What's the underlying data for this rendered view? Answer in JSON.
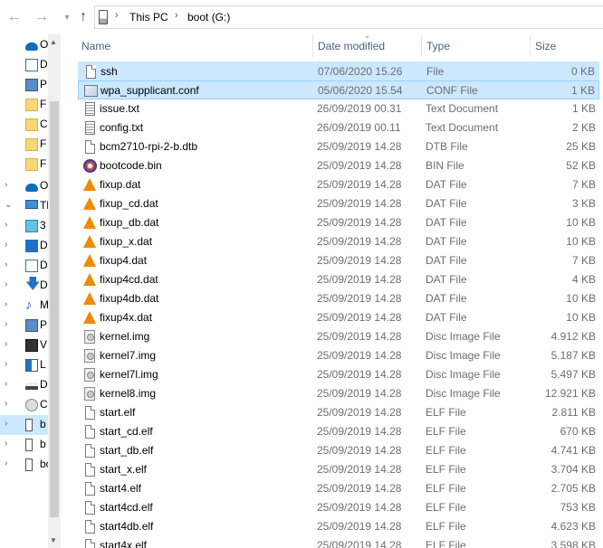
{
  "address": {
    "crumbs": [
      "This PC",
      "boot (G:)"
    ],
    "separator": "›"
  },
  "nav": {
    "items": [
      {
        "label": "O",
        "icon": "onedrive-icon",
        "expandable": false
      },
      {
        "label": "D",
        "icon": "document-icon",
        "expandable": false
      },
      {
        "label": "P",
        "icon": "picture-icon",
        "expandable": false
      },
      {
        "label": "F",
        "icon": "folder-icon",
        "expandable": false
      },
      {
        "label": "C",
        "icon": "folder-icon",
        "expandable": false
      },
      {
        "label": "F",
        "icon": "folder-icon",
        "expandable": false
      },
      {
        "label": "F",
        "icon": "folder-icon",
        "expandable": false
      },
      {
        "label": "O",
        "icon": "onedrive-icon",
        "expandable": true
      },
      {
        "label": "Th",
        "icon": "this-pc-icon",
        "expandable": true,
        "expanded": true
      },
      {
        "label": "3",
        "icon": "3d-objects-icon",
        "expandable": true
      },
      {
        "label": "D",
        "icon": "desktop-icon",
        "expandable": true
      },
      {
        "label": "D",
        "icon": "documents-icon",
        "expandable": true
      },
      {
        "label": "D",
        "icon": "downloads-icon",
        "expandable": true
      },
      {
        "label": "M",
        "icon": "music-icon",
        "expandable": true
      },
      {
        "label": "P",
        "icon": "pictures-icon",
        "expandable": true
      },
      {
        "label": "V",
        "icon": "videos-icon",
        "expandable": true
      },
      {
        "label": "L",
        "icon": "windows-drive-icon",
        "expandable": true
      },
      {
        "label": "D",
        "icon": "drive-icon",
        "expandable": true
      },
      {
        "label": "C",
        "icon": "dvd-drive-icon",
        "expandable": true
      },
      {
        "label": "b",
        "icon": "usb-drive-icon",
        "expandable": true,
        "selected": true
      },
      {
        "label": "b",
        "icon": "usb-drive-icon",
        "expandable": true
      },
      {
        "label": "bo",
        "icon": "usb-drive-icon",
        "expandable": true
      }
    ]
  },
  "columns": {
    "name": "Name",
    "date": "Date modified",
    "type": "Type",
    "size": "Size"
  },
  "files": [
    {
      "name": "ssh",
      "date": "07/06/2020 15.26",
      "type": "File",
      "size": "0 KB",
      "icon": "file-icon",
      "state": "selected"
    },
    {
      "name": "wpa_supplicant.conf",
      "date": "05/06/2020 15.54",
      "type": "CONF File",
      "size": "1 KB",
      "icon": "conf-file-icon",
      "state": "focused"
    },
    {
      "name": "issue.txt",
      "date": "26/09/2019 00.31",
      "type": "Text Document",
      "size": "1 KB",
      "icon": "text-file-icon"
    },
    {
      "name": "config.txt",
      "date": "26/09/2019 00.11",
      "type": "Text Document",
      "size": "2 KB",
      "icon": "text-file-icon"
    },
    {
      "name": "bcm2710-rpi-2-b.dtb",
      "date": "25/09/2019 14.28",
      "type": "DTB File",
      "size": "25 KB",
      "icon": "file-icon"
    },
    {
      "name": "bootcode.bin",
      "date": "25/09/2019 14.28",
      "type": "BIN File",
      "size": "52 KB",
      "icon": "bin-file-icon"
    },
    {
      "name": "fixup.dat",
      "date": "25/09/2019 14.28",
      "type": "DAT File",
      "size": "7 KB",
      "icon": "vlc-icon"
    },
    {
      "name": "fixup_cd.dat",
      "date": "25/09/2019 14.28",
      "type": "DAT File",
      "size": "3 KB",
      "icon": "vlc-icon"
    },
    {
      "name": "fixup_db.dat",
      "date": "25/09/2019 14.28",
      "type": "DAT File",
      "size": "10 KB",
      "icon": "vlc-icon"
    },
    {
      "name": "fixup_x.dat",
      "date": "25/09/2019 14.28",
      "type": "DAT File",
      "size": "10 KB",
      "icon": "vlc-icon"
    },
    {
      "name": "fixup4.dat",
      "date": "25/09/2019 14.28",
      "type": "DAT File",
      "size": "7 KB",
      "icon": "vlc-icon"
    },
    {
      "name": "fixup4cd.dat",
      "date": "25/09/2019 14.28",
      "type": "DAT File",
      "size": "4 KB",
      "icon": "vlc-icon"
    },
    {
      "name": "fixup4db.dat",
      "date": "25/09/2019 14.28",
      "type": "DAT File",
      "size": "10 KB",
      "icon": "vlc-icon"
    },
    {
      "name": "fixup4x.dat",
      "date": "25/09/2019 14.28",
      "type": "DAT File",
      "size": "10 KB",
      "icon": "vlc-icon"
    },
    {
      "name": "kernel.img",
      "date": "25/09/2019 14.28",
      "type": "Disc Image File",
      "size": "4.912 KB",
      "icon": "disc-image-icon"
    },
    {
      "name": "kernel7.img",
      "date": "25/09/2019 14.28",
      "type": "Disc Image File",
      "size": "5.187 KB",
      "icon": "disc-image-icon"
    },
    {
      "name": "kernel7l.img",
      "date": "25/09/2019 14.28",
      "type": "Disc Image File",
      "size": "5.497 KB",
      "icon": "disc-image-icon"
    },
    {
      "name": "kernel8.img",
      "date": "25/09/2019 14.28",
      "type": "Disc Image File",
      "size": "12.921 KB",
      "icon": "disc-image-icon"
    },
    {
      "name": "start.elf",
      "date": "25/09/2019 14.28",
      "type": "ELF File",
      "size": "2.811 KB",
      "icon": "file-icon"
    },
    {
      "name": "start_cd.elf",
      "date": "25/09/2019 14.28",
      "type": "ELF File",
      "size": "670 KB",
      "icon": "file-icon"
    },
    {
      "name": "start_db.elf",
      "date": "25/09/2019 14.28",
      "type": "ELF File",
      "size": "4.741 KB",
      "icon": "file-icon"
    },
    {
      "name": "start_x.elf",
      "date": "25/09/2019 14.28",
      "type": "ELF File",
      "size": "3.704 KB",
      "icon": "file-icon"
    },
    {
      "name": "start4.elf",
      "date": "25/09/2019 14.28",
      "type": "ELF File",
      "size": "2.705 KB",
      "icon": "file-icon"
    },
    {
      "name": "start4cd.elf",
      "date": "25/09/2019 14.28",
      "type": "ELF File",
      "size": "753 KB",
      "icon": "file-icon"
    },
    {
      "name": "start4db.elf",
      "date": "25/09/2019 14.28",
      "type": "ELF File",
      "size": "4.623 KB",
      "icon": "file-icon"
    },
    {
      "name": "start4x.elf",
      "date": "25/09/2019 14.28",
      "type": "ELF File",
      "size": "3.598 KB",
      "icon": "file-icon"
    }
  ],
  "colors": {
    "selection": "#cce8ff",
    "focus_border": "#99d1ff",
    "header_text": "#4c607a",
    "detail_text": "#6d6d6d"
  }
}
